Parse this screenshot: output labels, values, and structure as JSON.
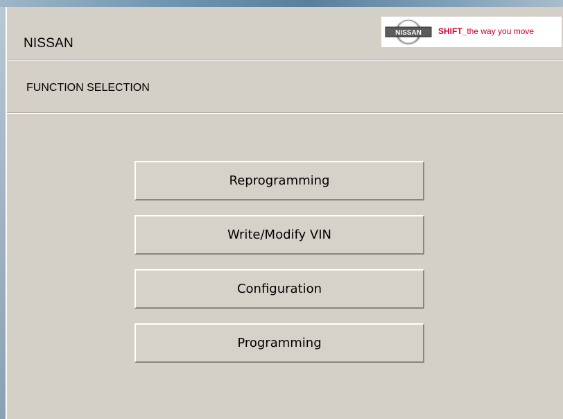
{
  "header": {
    "brand": "NISSAN",
    "logo": {
      "emblem_text": "NISSAN",
      "slogan_bold": "SHIFT_",
      "slogan_rest": "the way you move"
    }
  },
  "section": {
    "title": "FUNCTION SELECTION"
  },
  "functions": [
    {
      "label": "Reprogramming"
    },
    {
      "label": "Write/Modify VIN"
    },
    {
      "label": "Configuration"
    },
    {
      "label": "Programming"
    }
  ],
  "colors": {
    "background": "#d4d0c8",
    "slogan": "#d2002a"
  }
}
